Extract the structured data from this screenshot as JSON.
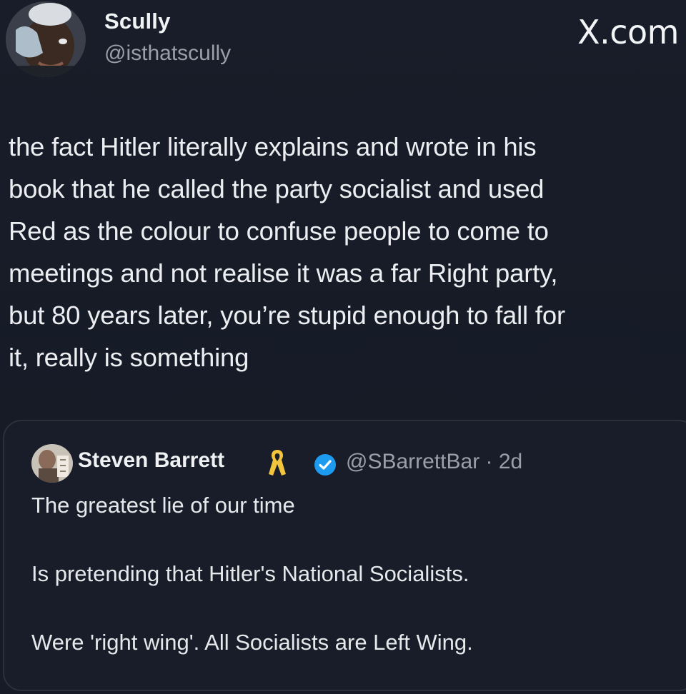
{
  "author": {
    "name": "Scully",
    "handle": "@isthatscully",
    "avatar": "profile-photo"
  },
  "brand": {
    "logo_text": ".com",
    "logo_mark": "X",
    "icon": "x-logo-icon"
  },
  "tweet": {
    "text": "the fact Hitler literally explains and wrote in his\nbook that he called the party socialist and used\nRed as the colour to confuse people to come to\nmeetings and not realise it was a far Right party,\nbut 80 years later, you’re stupid enough to fall for\nit, really is something"
  },
  "quote": {
    "name": "Steven Barrett",
    "handle_time": "@SBarrettBar · 2d",
    "badges": [
      "yellow-ribbon-icon",
      "verified-badge-icon"
    ],
    "verified_color": "#1d9bf0",
    "paragraphs": [
      "The greatest lie of our time",
      "Is pretending that Hitler's National Socialists.",
      "Were 'right wing'. All Socialists are Left Wing."
    ]
  },
  "colors": {
    "background": "#161b27",
    "text": "#e9ebee",
    "secondary_text": "#9aa0a8",
    "card_border": "#2a303c"
  }
}
